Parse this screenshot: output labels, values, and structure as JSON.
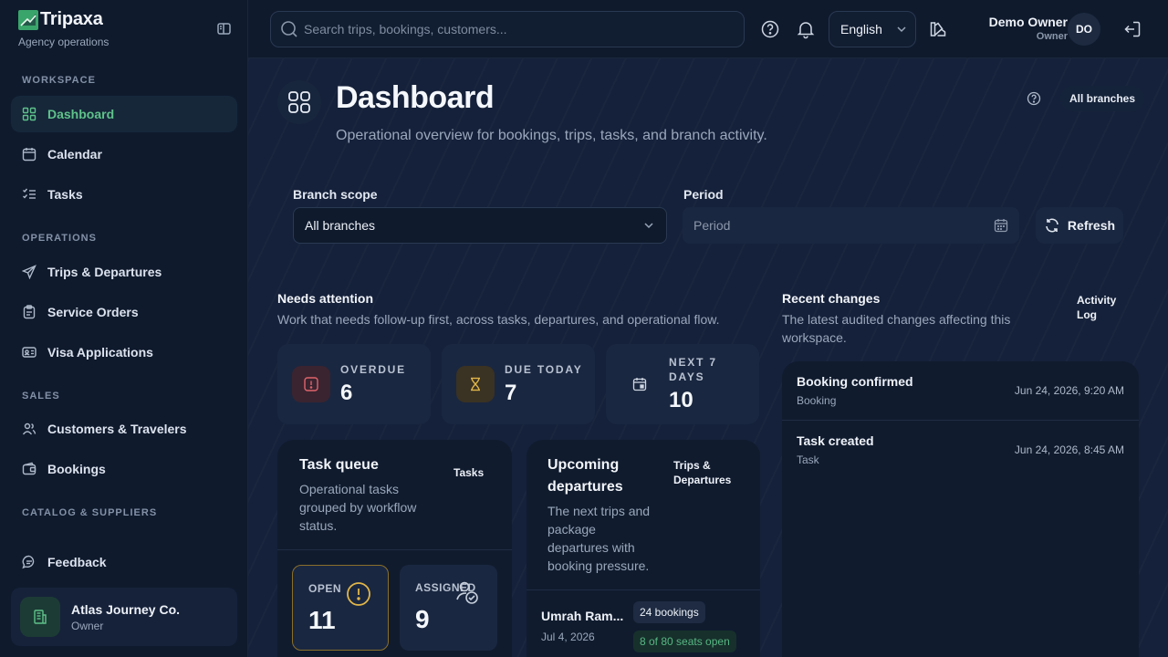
{
  "brand": {
    "name": "Tripaxa",
    "subtitle": "Agency operations"
  },
  "sidebar": {
    "sections": [
      "WORKSPACE",
      "OPERATIONS",
      "SALES",
      "CATALOG & SUPPLIERS"
    ],
    "items": [
      {
        "label": "Dashboard",
        "icon": "grid-icon",
        "active": true
      },
      {
        "label": "Calendar",
        "icon": "calendar-icon"
      },
      {
        "label": "Tasks",
        "icon": "list-check-icon"
      },
      {
        "label": "Trips & Departures",
        "icon": "send-icon"
      },
      {
        "label": "Service Orders",
        "icon": "clipboard-icon"
      },
      {
        "label": "Visa Applications",
        "icon": "id-card-icon"
      },
      {
        "label": "Customers & Travelers",
        "icon": "users-icon"
      },
      {
        "label": "Bookings",
        "icon": "wallet-icon"
      },
      {
        "label": "Feedback",
        "icon": "message-icon"
      }
    ],
    "org": {
      "name": "Atlas Journey Co.",
      "role": "Owner"
    }
  },
  "topbar": {
    "search_placeholder": "Search trips, bookings, customers...",
    "language": "English",
    "user_name": "Demo Owner",
    "user_role": "Owner",
    "avatar_initials": "DO"
  },
  "page": {
    "title": "Dashboard",
    "subtitle": "Operational overview for bookings, trips, tasks, and branch activity.",
    "branch_pill": "All branches"
  },
  "filters": {
    "branch_label": "Branch scope",
    "branch_value": "All branches",
    "period_label": "Period",
    "period_placeholder": "Period",
    "refresh_label": "Refresh"
  },
  "attention": {
    "title": "Needs attention",
    "subtitle": "Work that needs follow-up first, across tasks, departures, and operational flow.",
    "cards": [
      {
        "label": "OVERDUE",
        "value": "6"
      },
      {
        "label": "DUE TODAY",
        "value": "7"
      },
      {
        "label_line1": "NEXT 7",
        "label_line2": "DAYS",
        "value": "10"
      }
    ]
  },
  "task_queue": {
    "title": "Task queue",
    "link": "Tasks",
    "subtitle_lines": [
      "Operational tasks",
      "grouped by workflow",
      "status."
    ],
    "cards": [
      {
        "label": "OPEN",
        "value": "11"
      },
      {
        "label": "ASSIGNED",
        "value": "9"
      }
    ]
  },
  "departures": {
    "title_lines": [
      "Upcoming",
      "departures"
    ],
    "link_lines": [
      "Trips &",
      "Departures"
    ],
    "subtitle_lines": [
      "The next trips and",
      "package",
      "departures with",
      "booking pressure."
    ],
    "rows": [
      {
        "name": "Umrah Ram...",
        "date": "Jul 4, 2026",
        "bookings": "24 bookings",
        "seats": "8 of 80 seats open"
      }
    ]
  },
  "recent": {
    "title": "Recent changes",
    "link_lines": [
      "Activity",
      "Log"
    ],
    "subtitle_lines": [
      "The latest audited changes affecting this",
      "workspace."
    ],
    "rows": [
      {
        "title": "Booking confirmed",
        "type": "Booking",
        "time": "Jun 24, 2026, 9:20 AM"
      },
      {
        "title": "Task created",
        "type": "Task",
        "time": "Jun 24, 2026, 8:45 AM"
      }
    ]
  },
  "colors": {
    "accent": "#5ec28a",
    "overdue": "#e0646b",
    "due_today": "#e0b64a",
    "background": "#15213a"
  }
}
